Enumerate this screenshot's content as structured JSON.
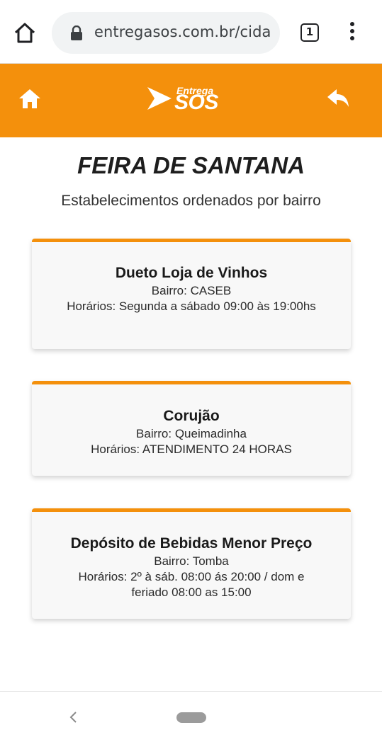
{
  "browser": {
    "url": "entregasos.com.br/cida",
    "tab_count": "1"
  },
  "header": {
    "logo_small": "Entrega",
    "logo_big": "SOS",
    "brand_color": "#f4900c"
  },
  "main": {
    "title": "FEIRA DE SANTANA",
    "subtitle": "Estabelecimentos ordenados por bairro"
  },
  "stores": [
    {
      "name": "Dueto Loja de Vinhos",
      "bairro": "Bairro: CASEB",
      "horarios": "Horários: Segunda a sábado 09:00 às 19:00hs"
    },
    {
      "name": "Corujão",
      "bairro": "Bairro: Queimadinha",
      "horarios": "Horários: ATENDIMENTO 24 HORAS"
    },
    {
      "name": "Depósito de Bebidas Menor Preço",
      "bairro": "Bairro: Tomba",
      "horarios": "Horários: 2º à sáb. 08:00 ás 20:00 / dom e feriado 08:00 as 15:00"
    }
  ]
}
